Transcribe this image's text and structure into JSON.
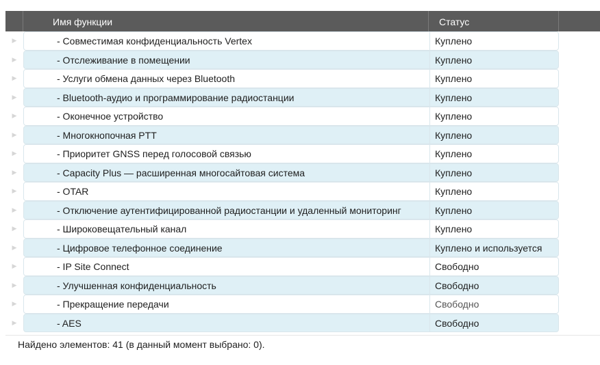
{
  "table": {
    "columns": {
      "name": "Имя функции",
      "status": "Статус"
    },
    "rows": [
      {
        "name": "- Совместимая конфиденциальность Vertex",
        "status": "Куплено"
      },
      {
        "name": "- Отслеживание в помещении",
        "status": "Куплено"
      },
      {
        "name": "- Услуги обмена данных через Bluetooth",
        "status": "Куплено"
      },
      {
        "name": "- Bluetooth-аудио и программирование радиостанции",
        "status": "Куплено"
      },
      {
        "name": "- Оконечное устройство",
        "status": "Куплено"
      },
      {
        "name": "- Многокнопочная PTT",
        "status": "Куплено"
      },
      {
        "name": "- Приоритет GNSS перед голосовой связью",
        "status": "Куплено"
      },
      {
        "name": "- Capacity Plus — расширенная многосайтовая система",
        "status": "Куплено"
      },
      {
        "name": "- OTAR",
        "status": "Куплено"
      },
      {
        "name": "- Отключение аутентифицированной радиостанции и удаленный мониторинг",
        "status": "Куплено"
      },
      {
        "name": "- Широковещательный канал",
        "status": "Куплено"
      },
      {
        "name": "- Цифровое телефонное соединение",
        "status": "Куплено и используется"
      },
      {
        "name": "- IP Site Connect",
        "status": "Свободно"
      },
      {
        "name": "- Улучшенная конфиденциальность",
        "status": "Свободно"
      },
      {
        "name": "- Прекращение передачи",
        "status": "Свободно"
      },
      {
        "name": "- AES",
        "status": "Свободно"
      }
    ]
  },
  "footer": {
    "text": "Найдено элементов: 41 (в данный момент выбрано: 0)."
  },
  "colors": {
    "header_bg": "#5b5b5b",
    "row_alt_bg": "#dff0f6",
    "row_border": "#d9e6ec"
  },
  "icons": {
    "row_indicator": "row-indicator-icon"
  }
}
